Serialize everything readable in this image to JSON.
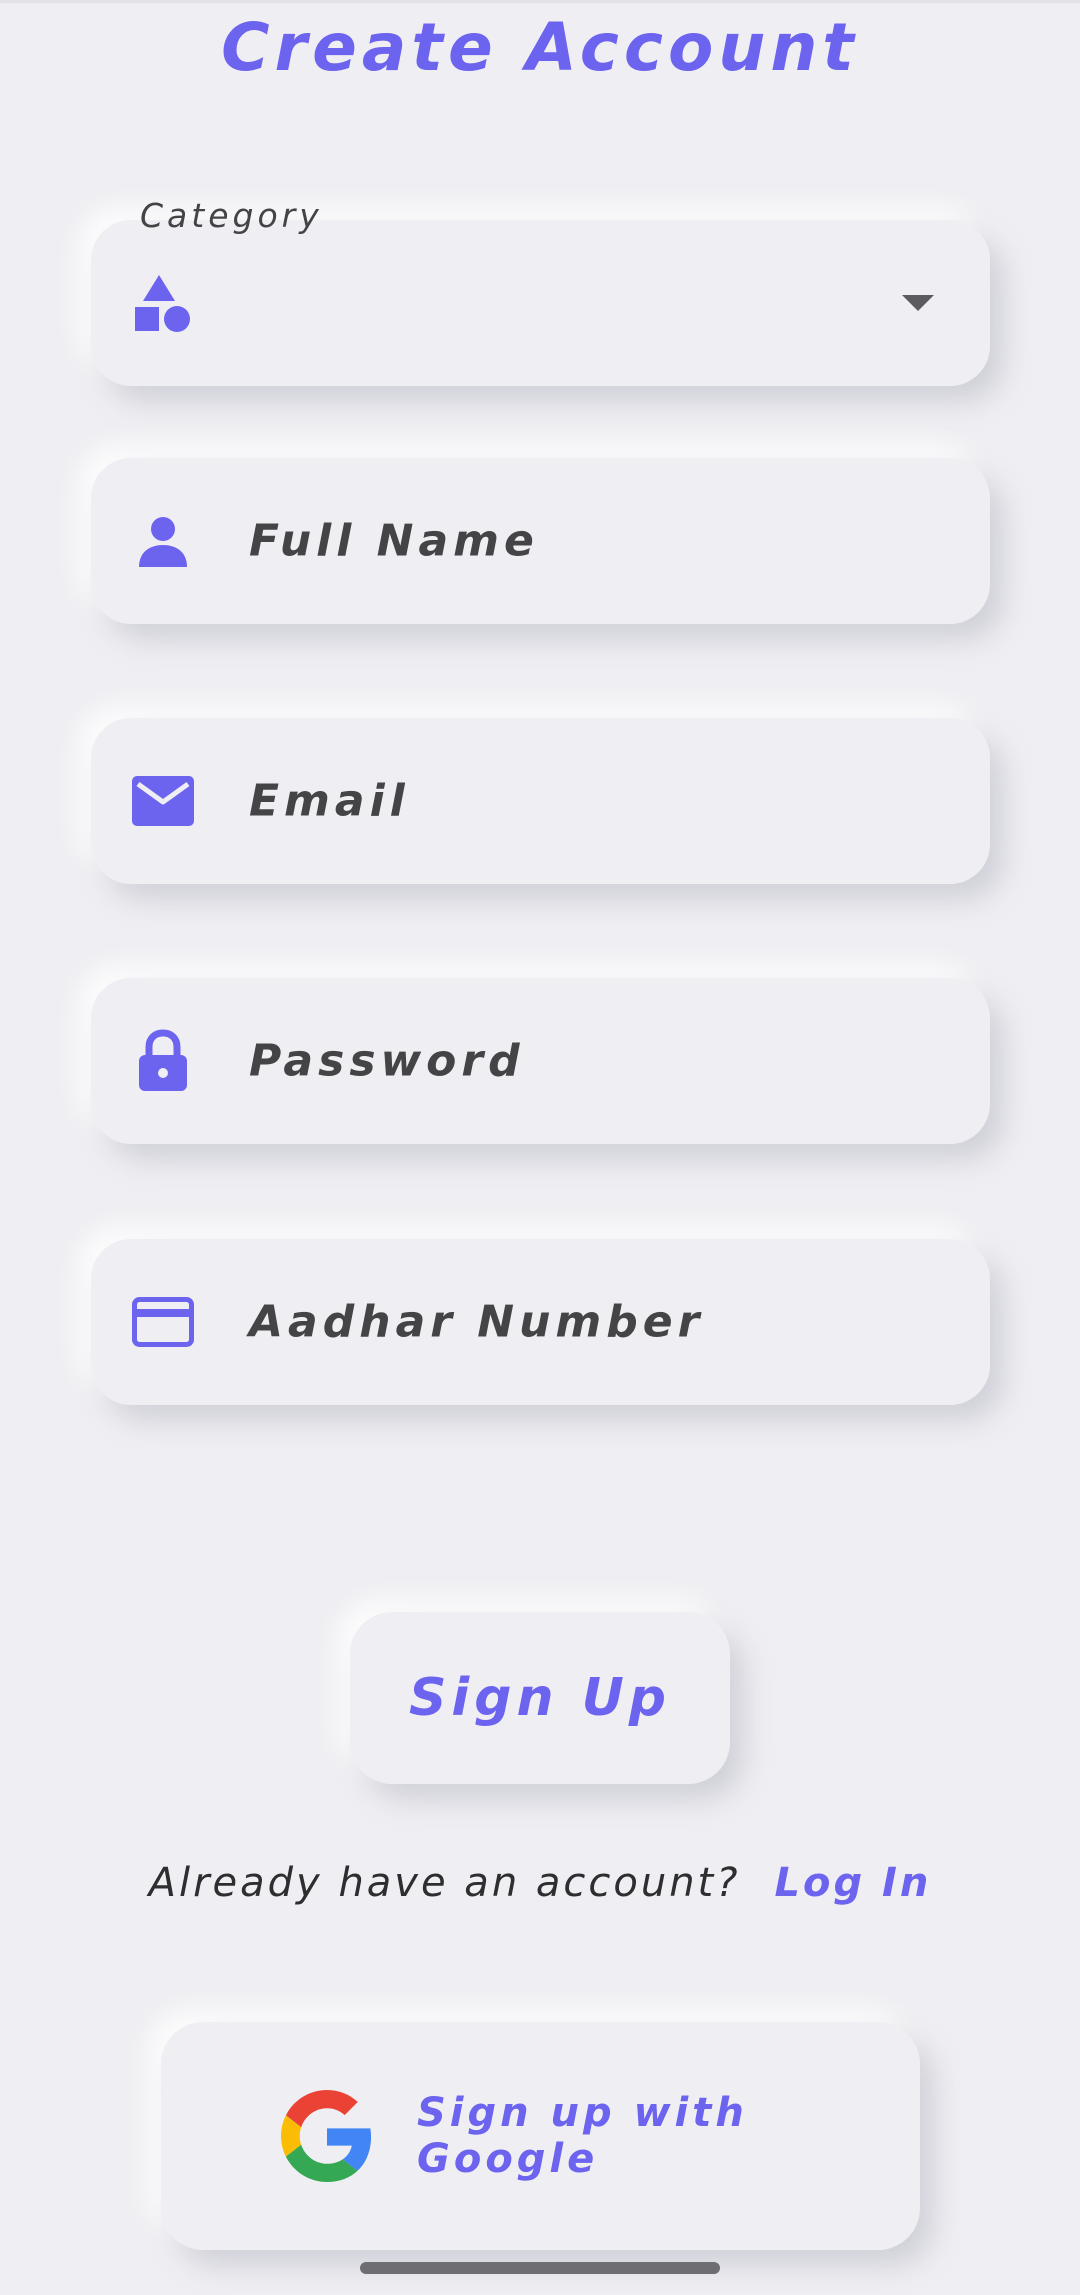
{
  "header": {
    "title": "Create Account"
  },
  "form": {
    "category": {
      "label": "Category",
      "icon": "category-shapes-icon",
      "value": ""
    },
    "full_name": {
      "placeholder": "Full Name",
      "icon": "person-icon"
    },
    "email": {
      "placeholder": "Email",
      "icon": "mail-icon"
    },
    "password": {
      "placeholder": "Password",
      "icon": "lock-icon"
    },
    "aadhar": {
      "placeholder": "Aadhar Number",
      "icon": "card-icon"
    }
  },
  "actions": {
    "signup_label": "Sign Up",
    "login_prompt": "Already have an account?",
    "login_link": "Log In",
    "google_label": "Sign up with Google"
  },
  "colors": {
    "accent": "#6c63ef",
    "background": "#efeff3",
    "text": "#444446"
  }
}
